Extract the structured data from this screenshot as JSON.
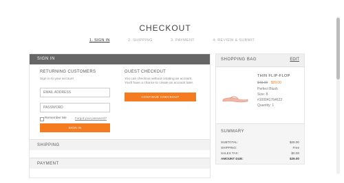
{
  "page": {
    "title": "CHECKOUT"
  },
  "steps": [
    {
      "label": "1. SIGN IN",
      "active": true
    },
    {
      "label": "2. SHIPPING",
      "active": false
    },
    {
      "label": "3. PAYMENT",
      "active": false
    },
    {
      "label": "4. REVIEW & SUBMIT",
      "active": false
    }
  ],
  "signin": {
    "header": "SIGN IN",
    "returning": {
      "title": "RETURNING CUSTOMERS",
      "subtitle": "Sign in to your account",
      "email_placeholder": "EMAIL ADDRESS",
      "password_placeholder": "PASSWORD",
      "remember_label": "Remember Me",
      "forgot_label": "Forgot your password?",
      "button_label": "SIGN IN"
    },
    "guest": {
      "title": "GUEST CHECKOUT",
      "description": "You can checkout without creating an account. You'll have a chance to create an account later.",
      "button_label": "CONTINUE CHECKOUT"
    }
  },
  "sections": {
    "shipping": "SHIPPING",
    "payment": "PAYMENT"
  },
  "bag": {
    "header": "SHOPPING BAG",
    "edit_label": "EDIT",
    "item": {
      "name": "THIN FLIP-FLOP",
      "price_old": "$48.00",
      "price_new": "$29.00",
      "color": "Perfect Blush",
      "size": "Size: 8",
      "sku": "#100041764622",
      "quantity": "Quantity: 1"
    }
  },
  "summary": {
    "header": "SUMMARY",
    "rows": [
      {
        "label": "SUBTOTAL:",
        "value": "$29.00"
      },
      {
        "label": "SHIPPING:",
        "value": "Free"
      },
      {
        "label": "SALES TAX:",
        "value": "$0.00"
      },
      {
        "label": "AMOUNT DUE:",
        "value": "$29.00"
      }
    ]
  },
  "colors": {
    "accent": "#f47b20",
    "header_bg": "#666666"
  }
}
